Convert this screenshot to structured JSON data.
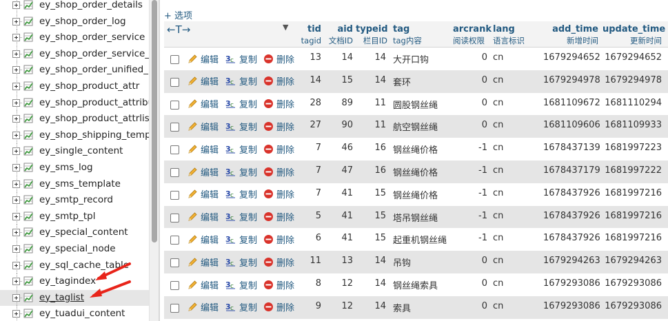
{
  "sidebar": {
    "tables": [
      "ey_shop_order_details",
      "ey_shop_order_log",
      "ey_shop_order_service",
      "ey_shop_order_service_lo",
      "ey_shop_order_unified_pa",
      "ey_shop_product_attr",
      "ey_shop_product_attribut",
      "ey_shop_product_attrlist",
      "ey_shop_shipping_templa",
      "ey_single_content",
      "ey_sms_log",
      "ey_sms_template",
      "ey_smtp_record",
      "ey_smtp_tpl",
      "ey_special_content",
      "ey_special_node",
      "ey_sql_cache_table",
      "ey_tagindex",
      "ey_taglist",
      "ey_tuadui_content"
    ],
    "selected_index": 18
  },
  "options_label": "+ 选项",
  "sort_arrows": "←T→",
  "columns": {
    "tid": {
      "name": "tid",
      "comment": "tagid"
    },
    "aid": {
      "name": "aid",
      "comment": "文档ID"
    },
    "typeid": {
      "name": "typeid",
      "comment": "栏目ID"
    },
    "tag": {
      "name": "tag",
      "comment": "tag内容"
    },
    "arcrank": {
      "name": "arcrank",
      "comment": "阅读权限"
    },
    "lang": {
      "name": "lang",
      "comment": "语言标识"
    },
    "add_time": {
      "name": "add_time",
      "comment": "新增时间"
    },
    "update_time": {
      "name": "update_time",
      "comment": "更新时间"
    }
  },
  "actions": {
    "edit": "编辑",
    "copy": "复制",
    "delete": "删除"
  },
  "rows": [
    {
      "tid": "13",
      "aid": "14",
      "typeid": "14",
      "tag": "大开口钩",
      "arcrank": "0",
      "lang": "cn",
      "add_time": "1679294652",
      "update_time": "1679294652"
    },
    {
      "tid": "14",
      "aid": "15",
      "typeid": "14",
      "tag": "套环",
      "arcrank": "0",
      "lang": "cn",
      "add_time": "1679294978",
      "update_time": "1679294978"
    },
    {
      "tid": "28",
      "aid": "89",
      "typeid": "11",
      "tag": "圆股钢丝绳",
      "arcrank": "0",
      "lang": "cn",
      "add_time": "1681109672",
      "update_time": "1681110294"
    },
    {
      "tid": "27",
      "aid": "90",
      "typeid": "11",
      "tag": "航空钢丝绳",
      "arcrank": "0",
      "lang": "cn",
      "add_time": "1681109606",
      "update_time": "1681109933"
    },
    {
      "tid": "7",
      "aid": "46",
      "typeid": "16",
      "tag": "钢丝绳价格",
      "arcrank": "-1",
      "lang": "cn",
      "add_time": "1678437139",
      "update_time": "1681997223"
    },
    {
      "tid": "7",
      "aid": "47",
      "typeid": "16",
      "tag": "钢丝绳价格",
      "arcrank": "-1",
      "lang": "cn",
      "add_time": "1678437179",
      "update_time": "1681997222"
    },
    {
      "tid": "7",
      "aid": "41",
      "typeid": "15",
      "tag": "钢丝绳价格",
      "arcrank": "-1",
      "lang": "cn",
      "add_time": "1678437926",
      "update_time": "1681997216"
    },
    {
      "tid": "5",
      "aid": "41",
      "typeid": "15",
      "tag": "塔吊钢丝绳",
      "arcrank": "-1",
      "lang": "cn",
      "add_time": "1678437926",
      "update_time": "1681997216"
    },
    {
      "tid": "6",
      "aid": "41",
      "typeid": "15",
      "tag": "起重机钢丝绳",
      "arcrank": "-1",
      "lang": "cn",
      "add_time": "1678437926",
      "update_time": "1681997216"
    },
    {
      "tid": "11",
      "aid": "13",
      "typeid": "14",
      "tag": "吊钩",
      "arcrank": "0",
      "lang": "cn",
      "add_time": "1679294263",
      "update_time": "1679294263"
    },
    {
      "tid": "8",
      "aid": "12",
      "typeid": "14",
      "tag": "钢丝绳索具",
      "arcrank": "0",
      "lang": "cn",
      "add_time": "1679293086",
      "update_time": "1679293086"
    },
    {
      "tid": "9",
      "aid": "12",
      "typeid": "14",
      "tag": "索具",
      "arcrank": "0",
      "lang": "cn",
      "add_time": "1679293086",
      "update_time": "1679293086"
    }
  ],
  "colors": {
    "link": "#235a81",
    "row_alt": "#e5e5e5",
    "arrow": "#e8241a",
    "delete_icon": "#d9332b"
  }
}
